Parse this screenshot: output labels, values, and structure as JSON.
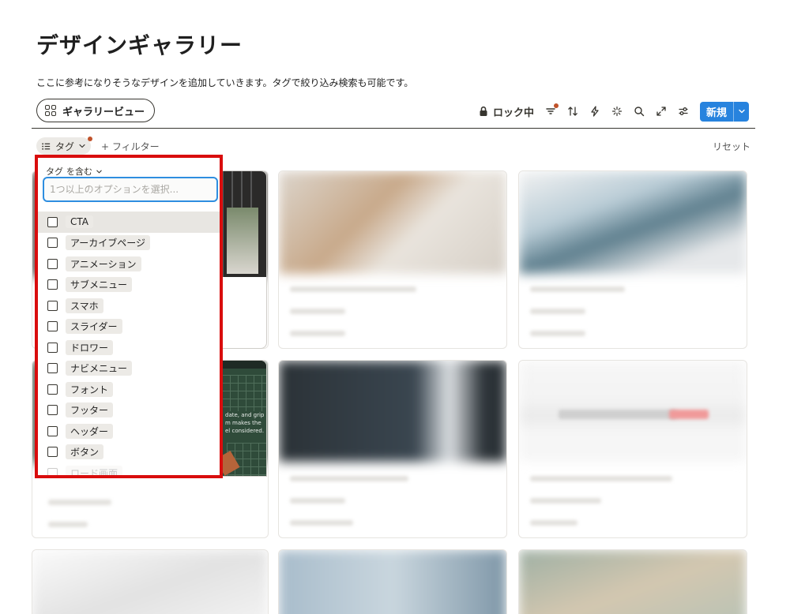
{
  "page": {
    "title": "デザインギャラリー",
    "description": "ここに参考になりそうなデザインを追加していきます。タグで絞り込み検索も可能です。"
  },
  "view_tab": {
    "label": "ギャラリービュー",
    "icon": "grid-icon"
  },
  "toolbar": {
    "lock_label": "ロック中",
    "new_label": "新規",
    "accent_color": "#2783de",
    "icons": [
      "lock-icon",
      "filter-icon",
      "sort-icon",
      "automation-icon",
      "ai-sparkle-icon",
      "search-icon",
      "expand-icon",
      "settings-icon"
    ]
  },
  "filter_bar": {
    "tag_label": "タグ",
    "add_filter_label": "フィルター",
    "reset_label": "リセット"
  },
  "tag_popup": {
    "condition_field": "タグ",
    "condition_op": "を含む",
    "placeholder": "1つ以上のオプションを選択...",
    "border_color": "#d90d0d",
    "options": [
      {
        "label": "CTA"
      },
      {
        "label": "アーカイブページ"
      },
      {
        "label": "アニメーション"
      },
      {
        "label": "サブメニュー"
      },
      {
        "label": "スマホ"
      },
      {
        "label": "スライダー"
      },
      {
        "label": "ドロワー"
      },
      {
        "label": "ナビメニュー"
      },
      {
        "label": "フォント"
      },
      {
        "label": "フッター"
      },
      {
        "label": "ヘッダー"
      },
      {
        "label": "ボタン"
      },
      {
        "label": "ロード画面"
      }
    ]
  },
  "card_snippet": {
    "lines": [
      "date, and grip in all",
      "m makes the",
      "el considered."
    ]
  }
}
